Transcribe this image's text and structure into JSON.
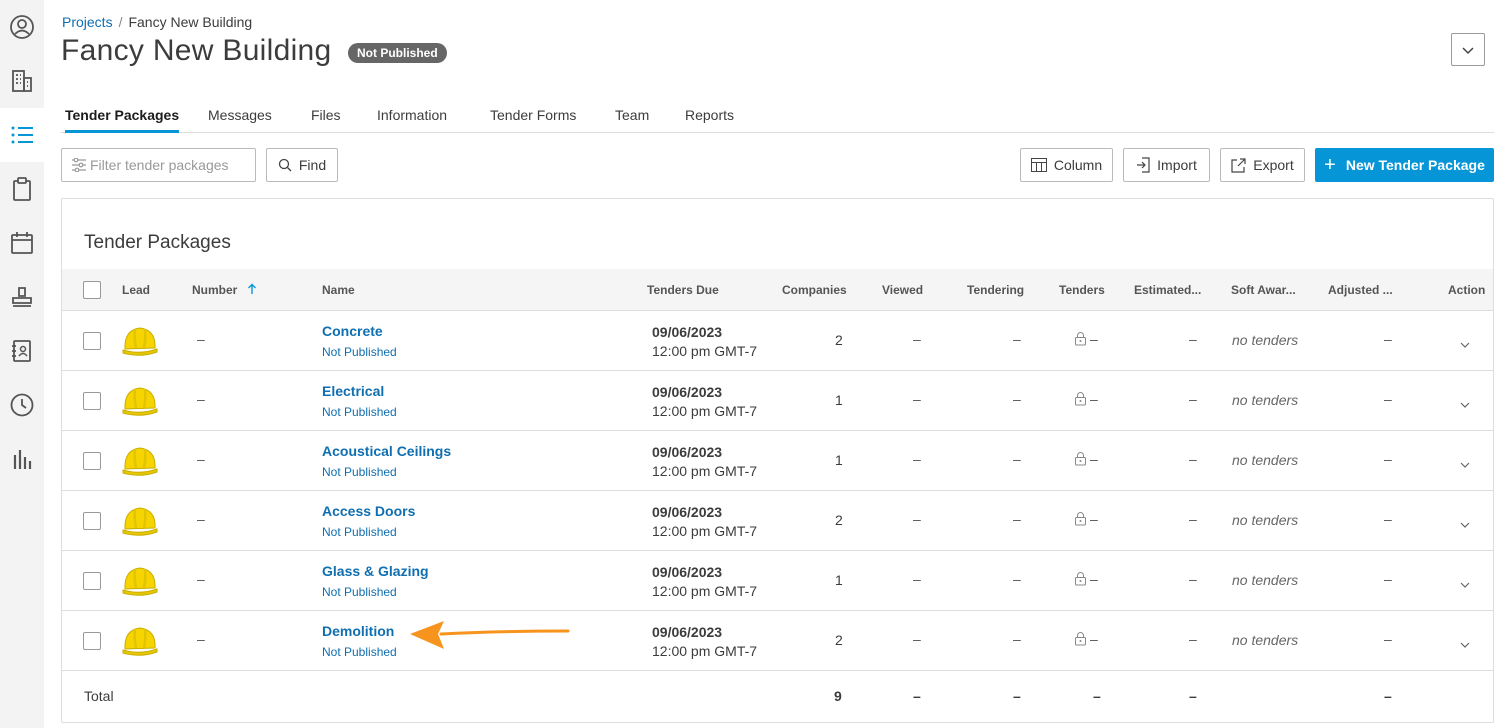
{
  "rail": {
    "items": [
      {
        "icon": "user-circle-icon"
      },
      {
        "icon": "building-icon"
      },
      {
        "icon": "list-icon",
        "active": true
      },
      {
        "icon": "clipboard-icon"
      },
      {
        "icon": "calendar-icon"
      },
      {
        "icon": "stamp-icon"
      },
      {
        "icon": "address-book-icon"
      },
      {
        "icon": "clock-icon"
      },
      {
        "icon": "bar-chart-icon"
      }
    ]
  },
  "breadcrumb": {
    "root": "Projects",
    "separator": "/",
    "current": "Fancy New Building"
  },
  "header": {
    "title": "Fancy New Building",
    "status": "Not Published"
  },
  "tabs": [
    {
      "label": "Tender Packages",
      "active": true
    },
    {
      "label": "Messages"
    },
    {
      "label": "Files"
    },
    {
      "label": "Information"
    },
    {
      "label": "Tender Forms"
    },
    {
      "label": "Team"
    },
    {
      "label": "Reports"
    }
  ],
  "toolbar": {
    "filter_placeholder": "Filter tender packages",
    "find_label": "Find",
    "column_label": "Column",
    "import_label": "Import",
    "export_label": "Export",
    "new_label": "New Tender Package"
  },
  "table": {
    "title": "Tender Packages",
    "headers": {
      "lead": "Lead",
      "number": "Number",
      "name": "Name",
      "due": "Tenders Due",
      "companies": "Companies",
      "viewed": "Viewed",
      "tendering": "Tendering",
      "tenders": "Tenders",
      "estimated": "Estimated...",
      "soft_award": "Soft Awar...",
      "adjusted": "Adjusted ...",
      "action": "Action"
    },
    "sort": {
      "column": "number",
      "direction": "ascending"
    },
    "rows": [
      {
        "number": "–",
        "name": "Concrete",
        "status": "Not Published",
        "date": "09/06/2023",
        "time": "12:00 pm GMT-7",
        "companies": "2",
        "viewed": "–",
        "tendering": "–",
        "tenders": "–",
        "estimated": "–",
        "soft_award": "no tenders",
        "adjusted": "–"
      },
      {
        "number": "–",
        "name": "Electrical",
        "status": "Not Published",
        "date": "09/06/2023",
        "time": "12:00 pm GMT-7",
        "companies": "1",
        "viewed": "–",
        "tendering": "–",
        "tenders": "–",
        "estimated": "–",
        "soft_award": "no tenders",
        "adjusted": "–"
      },
      {
        "number": "–",
        "name": "Acoustical Ceilings",
        "status": "Not Published",
        "date": "09/06/2023",
        "time": "12:00 pm GMT-7",
        "companies": "1",
        "viewed": "–",
        "tendering": "–",
        "tenders": "–",
        "estimated": "–",
        "soft_award": "no tenders",
        "adjusted": "–"
      },
      {
        "number": "–",
        "name": "Access Doors",
        "status": "Not Published",
        "date": "09/06/2023",
        "time": "12:00 pm GMT-7",
        "companies": "2",
        "viewed": "–",
        "tendering": "–",
        "tenders": "–",
        "estimated": "–",
        "soft_award": "no tenders",
        "adjusted": "–"
      },
      {
        "number": "–",
        "name": "Glass & Glazing",
        "status": "Not Published",
        "date": "09/06/2023",
        "time": "12:00 pm GMT-7",
        "companies": "1",
        "viewed": "–",
        "tendering": "–",
        "tenders": "–",
        "estimated": "–",
        "soft_award": "no tenders",
        "adjusted": "–"
      },
      {
        "number": "–",
        "name": "Demolition",
        "status": "Not Published",
        "date": "09/06/2023",
        "time": "12:00 pm GMT-7",
        "companies": "2",
        "viewed": "–",
        "tendering": "–",
        "tenders": "–",
        "estimated": "–",
        "soft_award": "no tenders",
        "adjusted": "–"
      }
    ],
    "total": {
      "label": "Total",
      "companies": "9",
      "viewed": "–",
      "tendering": "–",
      "tenders": "–",
      "estimated": "–",
      "adjusted": "–"
    }
  },
  "colors": {
    "accent": "#0696d7",
    "link": "#0f6fb0",
    "annotation_arrow": "#f7941d",
    "helmet": "#f5d400"
  }
}
